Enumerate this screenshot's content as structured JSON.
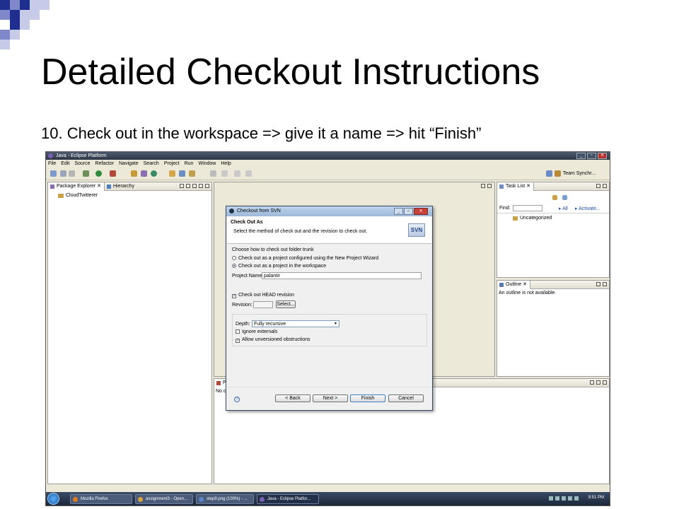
{
  "slide": {
    "title": "Detailed Checkout Instructions",
    "instruction": "10. Check out in the workspace => give it a name => hit “Finish”"
  },
  "eclipse": {
    "window_title": "Java - Eclipse Platform",
    "menu": [
      "File",
      "Edit",
      "Source",
      "Refactor",
      "Navigate",
      "Search",
      "Project",
      "Run",
      "Window",
      "Help"
    ],
    "toolbar_right_label": "Team Synchr...",
    "package_explorer": {
      "tabs": [
        "Package Explorer",
        "Hierarchy"
      ],
      "items": [
        "CloudTwitterer"
      ]
    },
    "task_list": {
      "tab": "Task List",
      "find_label": "Find:",
      "all_label": "All",
      "activate_label": "Activate...",
      "category": "Uncategorized"
    },
    "outline": {
      "tab": "Outline",
      "message": "An outline is not available."
    },
    "bottom_panel": {
      "tab_partial": "P",
      "message_partial": "No c"
    }
  },
  "dialog": {
    "title": "Checkout from SVN",
    "heading": "Check Out As",
    "description": "Select the method of check out and the revision to check out.",
    "logo_text": "SVN",
    "folder_prompt": "Choose how to check out folder trunk",
    "option_wizard": "Check out as a project configured using the New Project Wizard",
    "option_workspace": "Check out as a project in the workspace",
    "project_name_label": "Project Name:",
    "project_name_value": "palantir",
    "head_revision_label": "Check out HEAD revision",
    "revision_label": "Revision:",
    "select_button": "Select...",
    "depth_label": "Depth:",
    "depth_value": "Fully recursive",
    "ignore_externals": "Ignore externals",
    "allow_unversioned": "Allow unversioned obstructions",
    "buttons": {
      "back": "< Back",
      "next": "Next >",
      "finish": "Finish",
      "cancel": "Cancel"
    },
    "help": "?"
  },
  "taskbar": {
    "items": [
      "Mozilla Firefox",
      "assignment3 - Open...",
      "step9.png (100%) - ...",
      "Java - Eclipse Platfor..."
    ],
    "clock": "9:51 PM"
  }
}
